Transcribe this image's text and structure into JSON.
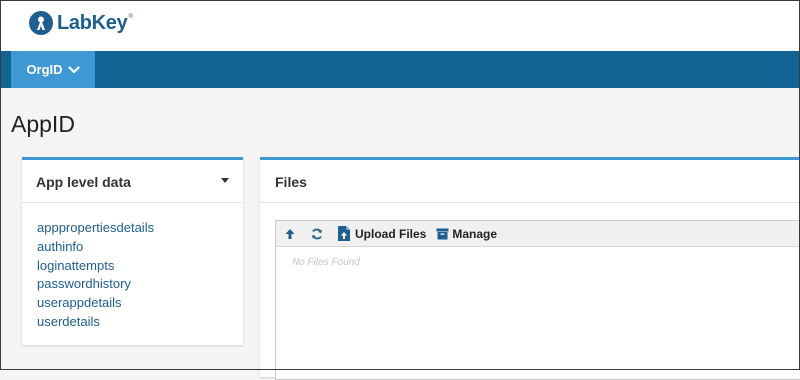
{
  "header": {
    "logo_text": "LabKey",
    "logo_tm": "®"
  },
  "nav": {
    "project_menu_label": "OrgID"
  },
  "page": {
    "title": "AppID"
  },
  "left_panel": {
    "title": "App level data",
    "items": [
      {
        "label": "apppropertiesdetails"
      },
      {
        "label": "authinfo"
      },
      {
        "label": "loginattempts"
      },
      {
        "label": "passwordhistory"
      },
      {
        "label": "userappdetails"
      },
      {
        "label": "userdetails"
      }
    ]
  },
  "files_panel": {
    "title": "Files",
    "toolbar": {
      "up_icon": "arrow-up-icon",
      "refresh_icon": "refresh-icon",
      "upload_label": "Upload Files",
      "manage_label": "Manage"
    },
    "empty_text": "No Files Found"
  },
  "colors": {
    "navbar": "#126495",
    "nav_tab": "#3d98d3",
    "panel_accent": "#3d98d3",
    "link": "#1e5f8f",
    "brand": "#1e5f8f"
  }
}
